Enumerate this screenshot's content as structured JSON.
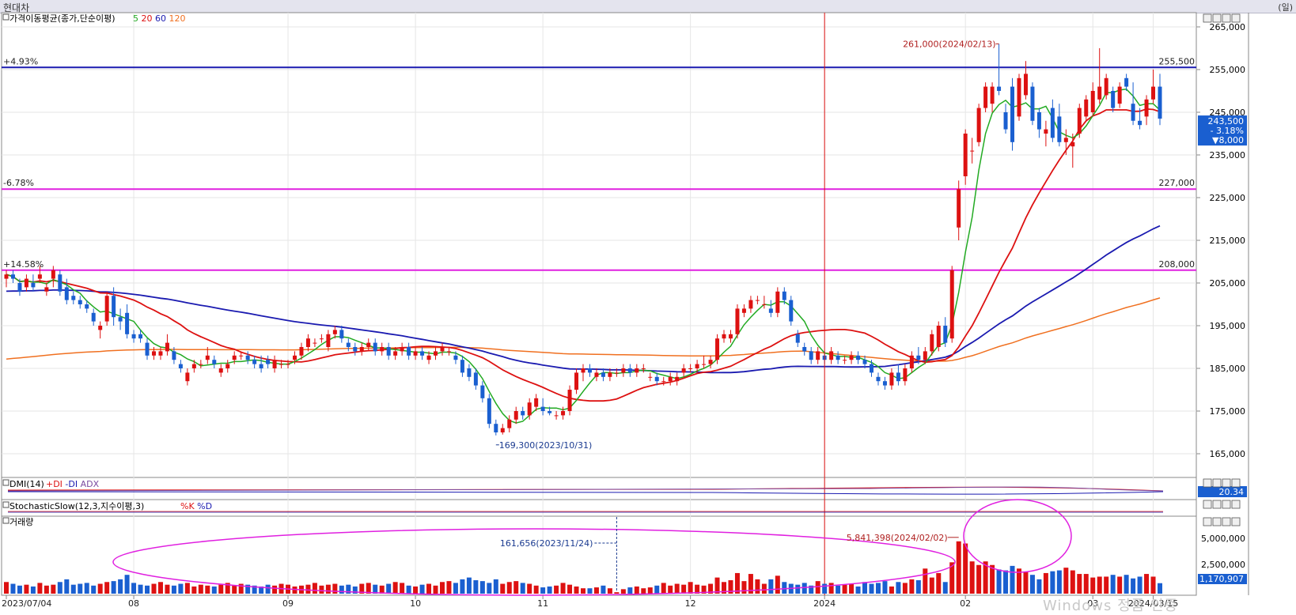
{
  "window": {
    "title": "현대차",
    "unit": "(일)"
  },
  "panels": {
    "price_title": "가격이동평균(종가,단순이평)",
    "price_ma_labels": [
      {
        "text": "5",
        "color": "#22aa22"
      },
      {
        "text": "20",
        "color": "#dd1111"
      },
      {
        "text": "60",
        "color": "#1a1ab0"
      },
      {
        "text": "120",
        "color": "#f07020"
      }
    ],
    "dmi_title": "DMI(14)",
    "dmi_legend": [
      {
        "text": "+DI",
        "color": "#dd1111"
      },
      {
        "text": "-DI",
        "color": "#1a1ab0"
      },
      {
        "text": "ADX",
        "color": "#7a4aa0"
      }
    ],
    "dmi_value": "20.34",
    "stoch_title": "StochasticSlow(12,3,지수이평,3)",
    "stoch_legend": [
      {
        "text": "%K",
        "color": "#dd1111"
      },
      {
        "text": "%D",
        "color": "#1a1ab0"
      }
    ],
    "volume_title": "거래량",
    "volume_value": "1,170,907",
    "volume_axis": [
      "5,000,000",
      "2,500,000"
    ]
  },
  "levels": [
    {
      "pct": "+4.93%",
      "price": "255,500",
      "value": 255500
    },
    {
      "pct": "-6.78%",
      "price": "227,000",
      "value": 227000
    },
    {
      "pct": "+14.58%",
      "price": "208,000",
      "value": 208000
    }
  ],
  "current_price": {
    "price": "243,500",
    "change": "- 3.18%",
    "diff": "▼8,000",
    "value": 243500
  },
  "annotations": {
    "high": "261,000(2024/02/13)",
    "low": "169,300(2023/10/31)",
    "vol_max": "5,841,398(2024/02/02)",
    "vol_min": "161,656(2023/11/24)"
  },
  "watermark": "Windows 정품 인증",
  "chart_data": {
    "type": "candlestick",
    "y_axis_ticks": [
      "265,000",
      "255,000",
      "245,000",
      "235,000",
      "225,000",
      "215,000",
      "205,000",
      "195,000",
      "185,000",
      "175,000",
      "165,000"
    ],
    "ylim": [
      165000,
      267000
    ],
    "x_labels": [
      {
        "text": "2023/07/04",
        "i": 0
      },
      {
        "text": "08",
        "i": 19
      },
      {
        "text": "09",
        "i": 42
      },
      {
        "text": "10",
        "i": 61
      },
      {
        "text": "11",
        "i": 80
      },
      {
        "text": "12",
        "i": 102
      },
      {
        "text": "2024",
        "i": 122
      },
      {
        "text": "02",
        "i": 143
      },
      {
        "text": "03",
        "i": 162
      },
      {
        "text": "2024/03/15",
        "i": 171
      }
    ],
    "ohlc": [
      [
        206000,
        208000,
        204000,
        207000
      ],
      [
        207000,
        208000,
        205000,
        206000
      ],
      [
        205000,
        206000,
        202000,
        203000
      ],
      [
        204000,
        207000,
        203000,
        206000
      ],
      [
        205000,
        207000,
        203000,
        204000
      ],
      [
        206000,
        209000,
        205000,
        207000
      ],
      [
        203000,
        205000,
        202000,
        204000
      ],
      [
        206000,
        209000,
        204000,
        208000
      ],
      [
        207000,
        208000,
        202000,
        203000
      ],
      [
        204000,
        206000,
        200000,
        201000
      ],
      [
        202000,
        203000,
        200000,
        201000
      ],
      [
        201000,
        202000,
        199000,
        200000
      ],
      [
        200000,
        201000,
        198000,
        199000
      ],
      [
        198000,
        199000,
        195000,
        196000
      ],
      [
        194000,
        196000,
        192000,
        195000
      ],
      [
        196000,
        203000,
        195000,
        202000
      ],
      [
        202000,
        204000,
        195000,
        197000
      ],
      [
        197000,
        199000,
        194000,
        196000
      ],
      [
        198000,
        200000,
        192000,
        193000
      ],
      [
        193000,
        194000,
        191000,
        192000
      ],
      [
        193000,
        194000,
        191000,
        192000
      ],
      [
        191000,
        192000,
        187000,
        188000
      ],
      [
        188000,
        190000,
        187000,
        189000
      ],
      [
        188000,
        190000,
        187000,
        189000
      ],
      [
        189000,
        193000,
        188000,
        191000
      ],
      [
        189000,
        190000,
        186000,
        187000
      ],
      [
        186000,
        187000,
        184000,
        185000
      ],
      [
        182000,
        185000,
        181000,
        184000
      ],
      [
        185000,
        187000,
        184000,
        186000
      ],
      [
        186000,
        187000,
        185000,
        186000
      ],
      [
        187000,
        190000,
        186000,
        188000
      ],
      [
        187000,
        188000,
        185000,
        186000
      ],
      [
        184000,
        186000,
        183000,
        185000
      ],
      [
        185000,
        187000,
        184000,
        186000
      ],
      [
        187000,
        189000,
        186000,
        188000
      ],
      [
        188000,
        189000,
        187000,
        188000
      ],
      [
        188000,
        189000,
        186000,
        187000
      ],
      [
        187000,
        188000,
        185000,
        186000
      ],
      [
        186000,
        188000,
        184000,
        185000
      ],
      [
        187000,
        188000,
        185000,
        186000
      ],
      [
        185000,
        188000,
        184000,
        187000
      ],
      [
        186000,
        187000,
        185000,
        186000
      ],
      [
        186000,
        187000,
        185000,
        186000
      ],
      [
        187000,
        189000,
        186000,
        188000
      ],
      [
        188000,
        191000,
        187000,
        190000
      ],
      [
        190000,
        193000,
        189000,
        192000
      ],
      [
        191000,
        192000,
        190000,
        191000
      ],
      [
        192000,
        193000,
        191000,
        192000
      ],
      [
        190000,
        194000,
        189000,
        193000
      ],
      [
        193000,
        195000,
        192000,
        194000
      ],
      [
        194000,
        195000,
        191000,
        192000
      ],
      [
        191000,
        192000,
        189000,
        190000
      ],
      [
        190000,
        191000,
        188000,
        189000
      ],
      [
        189000,
        191000,
        188000,
        190000
      ],
      [
        190000,
        192000,
        189000,
        191000
      ],
      [
        191000,
        192000,
        188000,
        189000
      ],
      [
        189000,
        191000,
        188000,
        190000
      ],
      [
        190000,
        191000,
        187000,
        188000
      ],
      [
        188000,
        190000,
        187000,
        189000
      ],
      [
        189000,
        191000,
        188000,
        190000
      ],
      [
        190000,
        191000,
        187000,
        188000
      ],
      [
        188000,
        190000,
        187000,
        189000
      ],
      [
        189000,
        190000,
        187000,
        188000
      ],
      [
        187000,
        189000,
        186000,
        188000
      ],
      [
        188000,
        190000,
        187000,
        189000
      ],
      [
        189000,
        191000,
        188000,
        190000
      ],
      [
        189000,
        190000,
        188000,
        189000
      ],
      [
        188000,
        189000,
        186000,
        187000
      ],
      [
        187000,
        188000,
        183000,
        184000
      ],
      [
        185000,
        186000,
        182000,
        183000
      ],
      [
        184000,
        185000,
        180000,
        181000
      ],
      [
        181000,
        182000,
        177000,
        178000
      ],
      [
        178000,
        179000,
        171000,
        172000
      ],
      [
        172000,
        173000,
        169300,
        170000
      ],
      [
        170000,
        172000,
        169500,
        171000
      ],
      [
        171000,
        174000,
        170000,
        173000
      ],
      [
        173000,
        176000,
        172000,
        175000
      ],
      [
        175000,
        176000,
        173000,
        174000
      ],
      [
        174000,
        178000,
        173000,
        177000
      ],
      [
        176000,
        179000,
        175000,
        178000
      ],
      [
        176000,
        178000,
        174000,
        175000
      ],
      [
        175000,
        176000,
        174000,
        174500
      ],
      [
        174000,
        175000,
        173000,
        174000
      ],
      [
        174000,
        176000,
        173000,
        175000
      ],
      [
        175000,
        181000,
        174000,
        180000
      ],
      [
        180000,
        185000,
        179000,
        184000
      ],
      [
        184000,
        186000,
        182000,
        185000
      ],
      [
        185000,
        186000,
        183000,
        184000
      ],
      [
        183000,
        185000,
        182000,
        184000
      ],
      [
        184000,
        185000,
        182000,
        183000
      ],
      [
        183000,
        185000,
        182000,
        184000
      ],
      [
        184000,
        185000,
        183000,
        184000
      ],
      [
        184000,
        186000,
        183000,
        185000
      ],
      [
        185000,
        186000,
        183000,
        184000
      ],
      [
        184000,
        186000,
        183000,
        185000
      ],
      [
        185000,
        186000,
        184000,
        185000
      ],
      [
        183000,
        184000,
        182000,
        183000
      ],
      [
        183000,
        184000,
        181000,
        182000
      ],
      [
        182000,
        183000,
        181000,
        182000
      ],
      [
        182000,
        184000,
        181000,
        183000
      ],
      [
        182000,
        184000,
        181000,
        183000
      ],
      [
        184000,
        186000,
        183000,
        185000
      ],
      [
        185000,
        186000,
        184000,
        185000
      ],
      [
        185000,
        187000,
        184000,
        186000
      ],
      [
        186000,
        188000,
        185000,
        186000
      ],
      [
        186000,
        188000,
        185000,
        187000
      ],
      [
        187000,
        193000,
        186000,
        192000
      ],
      [
        192000,
        194000,
        191000,
        193000
      ],
      [
        192000,
        194000,
        191000,
        193000
      ],
      [
        193000,
        200000,
        192000,
        199000
      ],
      [
        198000,
        200000,
        197000,
        199000
      ],
      [
        199000,
        202000,
        198000,
        201000
      ],
      [
        201000,
        202000,
        200000,
        201000
      ],
      [
        200000,
        202000,
        199000,
        200000
      ],
      [
        199000,
        201000,
        197000,
        198000
      ],
      [
        198000,
        204000,
        197000,
        203000
      ],
      [
        203000,
        204000,
        200000,
        201000
      ],
      [
        201000,
        202000,
        195000,
        196000
      ],
      [
        193000,
        194000,
        190000,
        191000
      ],
      [
        190000,
        191000,
        188000,
        189000
      ],
      [
        189000,
        190000,
        186000,
        187000
      ],
      [
        187000,
        190000,
        186000,
        189000
      ],
      [
        188000,
        189000,
        186000,
        187000
      ],
      [
        187000,
        190000,
        186000,
        189000
      ],
      [
        188000,
        189000,
        186000,
        187000
      ],
      [
        187000,
        188000,
        186000,
        187000
      ],
      [
        187000,
        189000,
        186000,
        188000
      ],
      [
        188000,
        189000,
        186000,
        187000
      ],
      [
        187000,
        188000,
        185000,
        186000
      ],
      [
        186000,
        187000,
        183000,
        184000
      ],
      [
        183000,
        184000,
        181000,
        182000
      ],
      [
        182000,
        183000,
        180000,
        181000
      ],
      [
        181000,
        185000,
        180000,
        184000
      ],
      [
        184000,
        186000,
        181000,
        182000
      ],
      [
        182000,
        186000,
        181000,
        185000
      ],
      [
        185000,
        189000,
        184000,
        188000
      ],
      [
        188000,
        190000,
        186000,
        187000
      ],
      [
        187000,
        190000,
        186000,
        189000
      ],
      [
        189000,
        194000,
        188000,
        193000
      ],
      [
        190000,
        196000,
        189000,
        195000
      ],
      [
        195000,
        197000,
        190000,
        191000
      ],
      [
        192000,
        209000,
        191000,
        208000
      ],
      [
        218000,
        229000,
        215000,
        227000
      ],
      [
        230000,
        241000,
        228000,
        240000
      ],
      [
        236000,
        239000,
        233000,
        236000
      ],
      [
        238000,
        247000,
        237000,
        246000
      ],
      [
        246000,
        252000,
        245000,
        251000
      ],
      [
        247000,
        252000,
        245000,
        251000
      ],
      [
        251000,
        261000,
        249000,
        250000
      ],
      [
        245000,
        247000,
        240000,
        241000
      ],
      [
        251000,
        253000,
        236000,
        238000
      ],
      [
        244000,
        254000,
        243000,
        253000
      ],
      [
        249000,
        257000,
        248000,
        254000
      ],
      [
        251000,
        252000,
        242000,
        243000
      ],
      [
        245000,
        246000,
        239000,
        241000
      ],
      [
        240000,
        243000,
        237000,
        241000
      ],
      [
        246000,
        248000,
        238000,
        239000
      ],
      [
        244000,
        247000,
        237000,
        238000
      ],
      [
        238000,
        241000,
        235000,
        239000
      ],
      [
        237000,
        240000,
        232000,
        238000
      ],
      [
        240000,
        247000,
        239000,
        246000
      ],
      [
        244000,
        249000,
        243000,
        248000
      ],
      [
        245000,
        252000,
        244000,
        250000
      ],
      [
        248000,
        260000,
        247000,
        251000
      ],
      [
        249000,
        254000,
        248000,
        253000
      ],
      [
        250000,
        251000,
        245000,
        246000
      ],
      [
        247000,
        252000,
        246000,
        251000
      ],
      [
        253000,
        254000,
        250000,
        251000
      ],
      [
        247000,
        252000,
        242000,
        243000
      ],
      [
        243000,
        246000,
        241000,
        242000
      ],
      [
        244000,
        249000,
        242000,
        248000
      ],
      [
        248000,
        255000,
        247000,
        251000
      ],
      [
        251000,
        254000,
        242000,
        243500
      ]
    ],
    "ma5_color": "#22aa22",
    "ma20_color": "#dd1111",
    "ma60_color": "#1a1ab0",
    "ma120_color": "#f07020",
    "up_color": "#dd1111",
    "down_color": "#1a5fd0",
    "volume": [
      1.3,
      1.1,
      0.9,
      1.0,
      0.8,
      1.2,
      0.9,
      1.0,
      1.3,
      1.6,
      1.0,
      1.1,
      1.2,
      0.9,
      1.1,
      1.3,
      1.4,
      1.6,
      2.1,
      1.2,
      1.0,
      0.9,
      1.1,
      1.3,
      1.0,
      0.9,
      1.1,
      1.2,
      0.8,
      1.0,
      0.9,
      0.8,
      1.0,
      1.2,
      0.9,
      1.1,
      1.0,
      0.9,
      0.8,
      1.0,
      0.9,
      1.1,
      1.0,
      0.8,
      0.9,
      1.0,
      1.2,
      0.9,
      1.0,
      1.1,
      0.9,
      1.0,
      0.8,
      1.1,
      1.2,
      1.0,
      0.9,
      1.1,
      1.3,
      1.2,
      0.9,
      0.8,
      1.0,
      1.1,
      0.9,
      1.3,
      1.4,
      1.2,
      1.6,
      1.8,
      1.5,
      1.4,
      1.2,
      1.6,
      1.1,
      1.3,
      1.4,
      1.2,
      1.1,
      0.9,
      0.7,
      0.8,
      0.9,
      1.2,
      1.0,
      0.8,
      0.6,
      0.6,
      0.7,
      0.9,
      0.6,
      0.16,
      0.5,
      0.7,
      0.8,
      0.6,
      0.7,
      0.9,
      1.2,
      0.9,
      1.1,
      1.0,
      1.3,
      1.0,
      0.9,
      1.1,
      1.8,
      1.3,
      1.5,
      2.3,
      1.4,
      2.2,
      1.6,
      1.1,
      1.6,
      2.0,
      1.3,
      1.1,
      1.0,
      1.2,
      0.9,
      1.4,
      1.1,
      1.2,
      0.9,
      1.0,
      1.1,
      0.8,
      1.3,
      1.1,
      1.2,
      1.4,
      0.8,
      1.3,
      1.2,
      1.6,
      1.5,
      2.8,
      1.8,
      2.3,
      1.3,
      3.5,
      5.84,
      5.6,
      3.6,
      3.2,
      3.6,
      3.2,
      2.7,
      2.6,
      3.1,
      2.8,
      2.4,
      2.1,
      1.6,
      2.3,
      2.5,
      2.6,
      2.9,
      2.6,
      2.2,
      2.2,
      1.8,
      1.9,
      1.9,
      2.1,
      1.9,
      2.1,
      1.7,
      1.9,
      2.2,
      1.9,
      1.17
    ]
  }
}
